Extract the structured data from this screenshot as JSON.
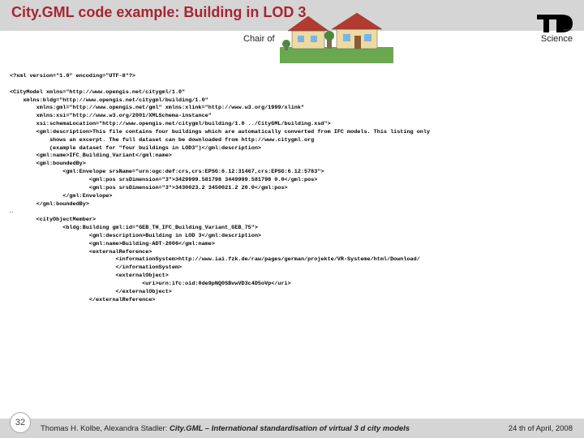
{
  "header": {
    "title": "City.GML code example: Building in LOD 3",
    "subtitle_left": "Chair of",
    "subtitle_right": "Science"
  },
  "code": {
    "l01": "<?xml version=\"1.0\" encoding=\"UTF-8\"?>",
    "l02": "<CityModel xmlns=\"http://www.opengis.net/citygml/1.0\"",
    "l03": "    xmlns:bldg=\"http://www.opengis.net/citygml/building/1.0\"",
    "l04": "    xmlns:gml=\"http://www.opengis.net/gml\" xmlns:xlink=\"http://www.w3.org/1999/xlink\"",
    "l05": "    xmlns:xsi=\"http://www.w3.org/2001/XMLSchema-instance\"",
    "l06": "    xsi:schemaLocation=\"http://www.opengis.net/citygml/building/1.0 ../CityGML/building.xsd\">",
    "l07": "    <gml:description>This file contains four buildings which are automatically converted from IFC models. This listing only",
    "l07b": "        shows an excerpt. The full dataset can be downloaded from http://www.citygml.org",
    "l07c": "        (example dataset for \"four buildings in LOD3\")</gml:description>",
    "l08": "    <gml:name>IFC_Building_Variant</gml:name>",
    "l09": "    <gml:boundedBy>",
    "l10": "        <gml:Envelope srsName=\"urn:ogc:def:crs,crs:EPSG:6.12:31467,crs:EPSG:6.12:5783\">",
    "l11": "            <gml:pos srsDimension=\"3\">3429999.581798 3449999.581798 0.0</gml:pos>",
    "l12": "            <gml:pos srsDimension=\"3\">3430023.2 3450021.2 20.0</gml:pos>",
    "l13": "        </gml:Envelope>",
    "l14": "    </gml:boundedBy>",
    "l15": "…",
    "l16": "    <cityObjectMember>",
    "l17": "        <bldg:Building gml:id=\"GEB_TH_IFC_Building_Variant_GEB_75\">",
    "l18": "            <gml:description>Building in LOD 3</gml:description>",
    "l19": "            <gml:name>Building-ADT-2006</gml:name>",
    "l20": "            <externalReference>",
    "l21": "                <informationSystem>http://www.iai.fzk.de/raw/pages/german/projekte/VR-Systeme/html/Download/",
    "l22": "                </informationSystem>",
    "l23": "                <externalObject>",
    "l24": "                    <uri>urn:ifc:oid:0de9pNQ0SBvwVD3c4D5oVp</uri>",
    "l25": "                </externalObject>",
    "l26": "            </externalReference>"
  },
  "footer": {
    "authors": "Thomas H. Kolbe, Alexandra Stadler:",
    "talk_title": "City.GML – International standardisation of virtual 3 d city models",
    "date": "24 th of April, 2008",
    "page": "32"
  }
}
